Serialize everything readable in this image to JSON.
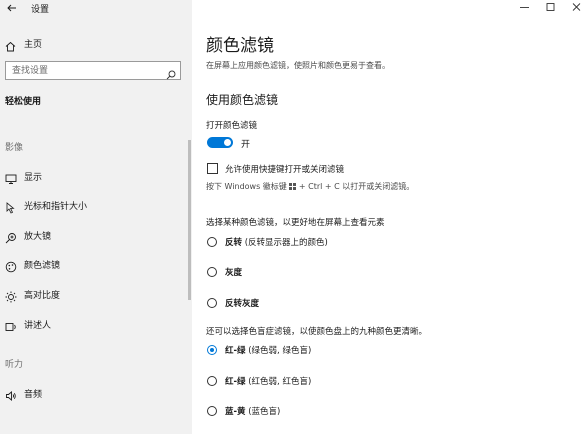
{
  "window": {
    "title": "设置",
    "minimize_glyph": "—",
    "maximize_glyph": "☐",
    "close_glyph": "✕"
  },
  "sidebar": {
    "home_label": "主页",
    "search_placeholder": "查找设置",
    "section_title": "轻松使用",
    "groups": [
      {
        "label": "影像",
        "items": [
          {
            "label": "显示",
            "icon": "display-icon"
          },
          {
            "label": "光标和指针大小",
            "icon": "cursor-icon"
          },
          {
            "label": "放大镜",
            "icon": "magnifier-icon"
          },
          {
            "label": "颜色滤镜",
            "icon": "color-filter-icon"
          },
          {
            "label": "高对比度",
            "icon": "high-contrast-icon"
          },
          {
            "label": "讲述人",
            "icon": "narrator-icon"
          }
        ]
      },
      {
        "label": "听力",
        "items": [
          {
            "label": "音频",
            "icon": "speaker-icon"
          }
        ]
      }
    ]
  },
  "main": {
    "title": "颜色滤镜",
    "description": "在屏幕上应用颜色滤镜，使照片和颜色更易于查看。",
    "use_heading": "使用颜色滤镜",
    "toggle_caption": "打开颜色滤镜",
    "toggle_state": "开",
    "toggle_on": true,
    "shortcut_checkbox_label": "允许使用快捷键打开或关闭滤镜",
    "shortcut_checked": false,
    "hint_before": "按下 Windows 徽标键",
    "hint_after": "+ Ctrl + C 以打开或关闭滤镜。",
    "filter_prompt": "选择某种颜色滤镜，以更好地在屏幕上查看元素",
    "filters": [
      {
        "bold": "反转",
        "sub": "(反转显示器上的颜色)",
        "checked": false
      },
      {
        "bold": "灰度",
        "sub": "",
        "checked": false
      },
      {
        "bold": "反转灰度",
        "sub": "",
        "checked": false
      }
    ],
    "colorblind_prompt": "还可以选择色盲症滤镜，以使颜色盘上的九种颜色更清晰。",
    "colorblind_filters": [
      {
        "bold": "红-绿",
        "sub": "(绿色弱, 绿色盲)",
        "checked": true
      },
      {
        "bold": "红-绿",
        "sub": "(红色弱, 红色盲)",
        "checked": false
      },
      {
        "bold": "蓝-黄",
        "sub": "(蓝色盲)",
        "checked": false
      }
    ]
  },
  "colors": {
    "accent": "#0078d7",
    "sidebar_bg": "#f1f1f1"
  }
}
